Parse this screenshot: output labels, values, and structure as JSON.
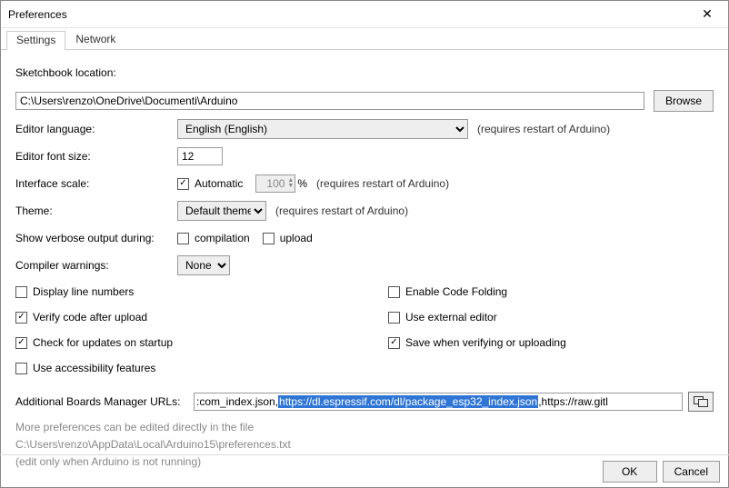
{
  "window": {
    "title": "Preferences"
  },
  "tabs": {
    "settings": "Settings",
    "network": "Network"
  },
  "labels": {
    "sketchbook": "Sketchbook location:",
    "editor_language": "Editor language:",
    "editor_font_size": "Editor font size:",
    "interface_scale": "Interface scale:",
    "theme": "Theme:",
    "verbose": "Show verbose output during:",
    "compiler_warnings": "Compiler warnings:",
    "additional_urls": "Additional Boards Manager URLs:"
  },
  "values": {
    "sketchbook_path": "C:\\Users\\renzo\\OneDrive\\Documenti\\Arduino",
    "language": "English (English)",
    "font_size": "12",
    "scale_value": "100",
    "theme": "Default theme",
    "warnings": "None"
  },
  "buttons": {
    "browse": "Browse",
    "ok": "OK",
    "cancel": "Cancel"
  },
  "notes": {
    "restart": "(requires restart of Arduino)",
    "percent": "%"
  },
  "checks": {
    "automatic": "Automatic",
    "compilation": "compilation",
    "upload": "upload",
    "display_line_numbers": "Display line numbers",
    "enable_code_folding": "Enable Code Folding",
    "verify_after_upload": "Verify code after upload",
    "use_external_editor": "Use external editor",
    "check_updates": "Check for updates on startup",
    "save_when_verifying": "Save when verifying or uploading",
    "accessibility": "Use accessibility features"
  },
  "check_states": {
    "automatic": true,
    "compilation": false,
    "upload": false,
    "display_line_numbers": false,
    "enable_code_folding": false,
    "verify_after_upload": true,
    "use_external_editor": false,
    "check_updates": true,
    "save_when_verifying": true,
    "accessibility": false
  },
  "urls": {
    "pre": ":com_index.json,",
    "selected": "https://dl.espressif.com/dl/package_esp32_index.json",
    "post": ",https://raw.gitl"
  },
  "hints": {
    "line1": "More preferences can be edited directly in the file",
    "line2": "C:\\Users\\renzo\\AppData\\Local\\Arduino15\\preferences.txt",
    "line3": "(edit only when Arduino is not running)"
  }
}
